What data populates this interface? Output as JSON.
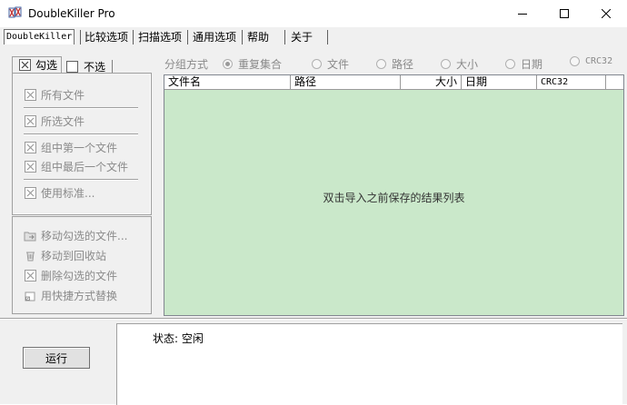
{
  "window": {
    "title": "DoubleKiller Pro"
  },
  "main_tabs": [
    {
      "label": "DoubleKiller"
    },
    {
      "label": "比较选项"
    },
    {
      "label": "扫描选项"
    },
    {
      "label": "通用选项"
    },
    {
      "label": "帮助"
    },
    {
      "label": "关于"
    }
  ],
  "left_pane": {
    "tab_check": "勾选",
    "tab_uncheck": "不选",
    "select_buttons": [
      "所有文件",
      "所选文件",
      "组中第一个文件",
      "组中最后一个文件",
      "使用标准..."
    ],
    "action_buttons": [
      "移动勾选的文件...",
      "移动到回收站",
      "删除勾选的文件",
      "用快捷方式替换"
    ]
  },
  "grouping": {
    "label": "分组方式",
    "options": [
      {
        "label": "重复集合",
        "checked": true
      },
      {
        "label": "文件",
        "checked": false
      },
      {
        "label": "路径",
        "checked": false
      },
      {
        "label": "大小",
        "checked": false
      },
      {
        "label": "日期",
        "checked": false
      },
      {
        "label": "CRC32",
        "checked": false
      }
    ]
  },
  "list": {
    "columns": [
      "文件名",
      "路径",
      "大小",
      "日期",
      "CRC32"
    ],
    "empty_message": "双击导入之前保存的结果列表",
    "background": "#cae8ca"
  },
  "run_button": "运行",
  "status": {
    "text": "状态: 空闲"
  }
}
